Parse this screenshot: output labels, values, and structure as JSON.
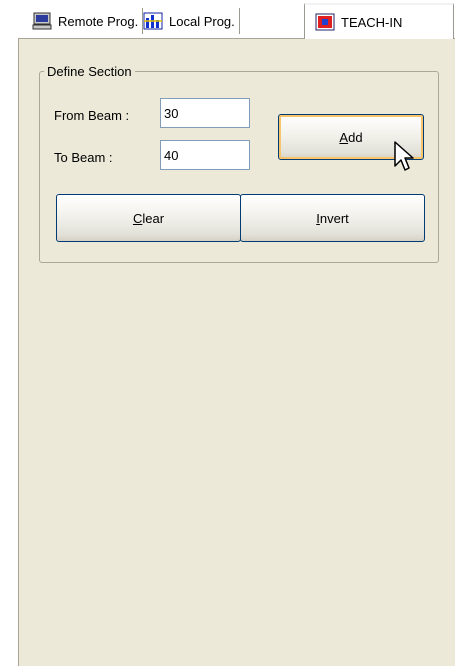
{
  "tabs": [
    {
      "label": "Remote Prog.",
      "icon": "computer-icon",
      "selected": false
    },
    {
      "label": "Local Prog.",
      "icon": "chart-icon",
      "selected": false
    },
    {
      "label": "TEACH-IN",
      "icon": "red-square-icon",
      "selected": true
    }
  ],
  "group": {
    "title": "Define Section"
  },
  "from_beam": {
    "label": "From Beam :",
    "value": "30"
  },
  "to_beam": {
    "label": "To Beam :",
    "value": "40"
  },
  "buttons": {
    "add": {
      "mnemonic": "A",
      "rest": "dd"
    },
    "clear": {
      "mnemonic": "C",
      "rest": "lear"
    },
    "invert": {
      "mnemonic": "I",
      "rest": "nvert"
    }
  },
  "colors": {
    "panel_bg": "#ece9d8",
    "button_border": "#003c74",
    "hot_border": "#f8c46c"
  }
}
